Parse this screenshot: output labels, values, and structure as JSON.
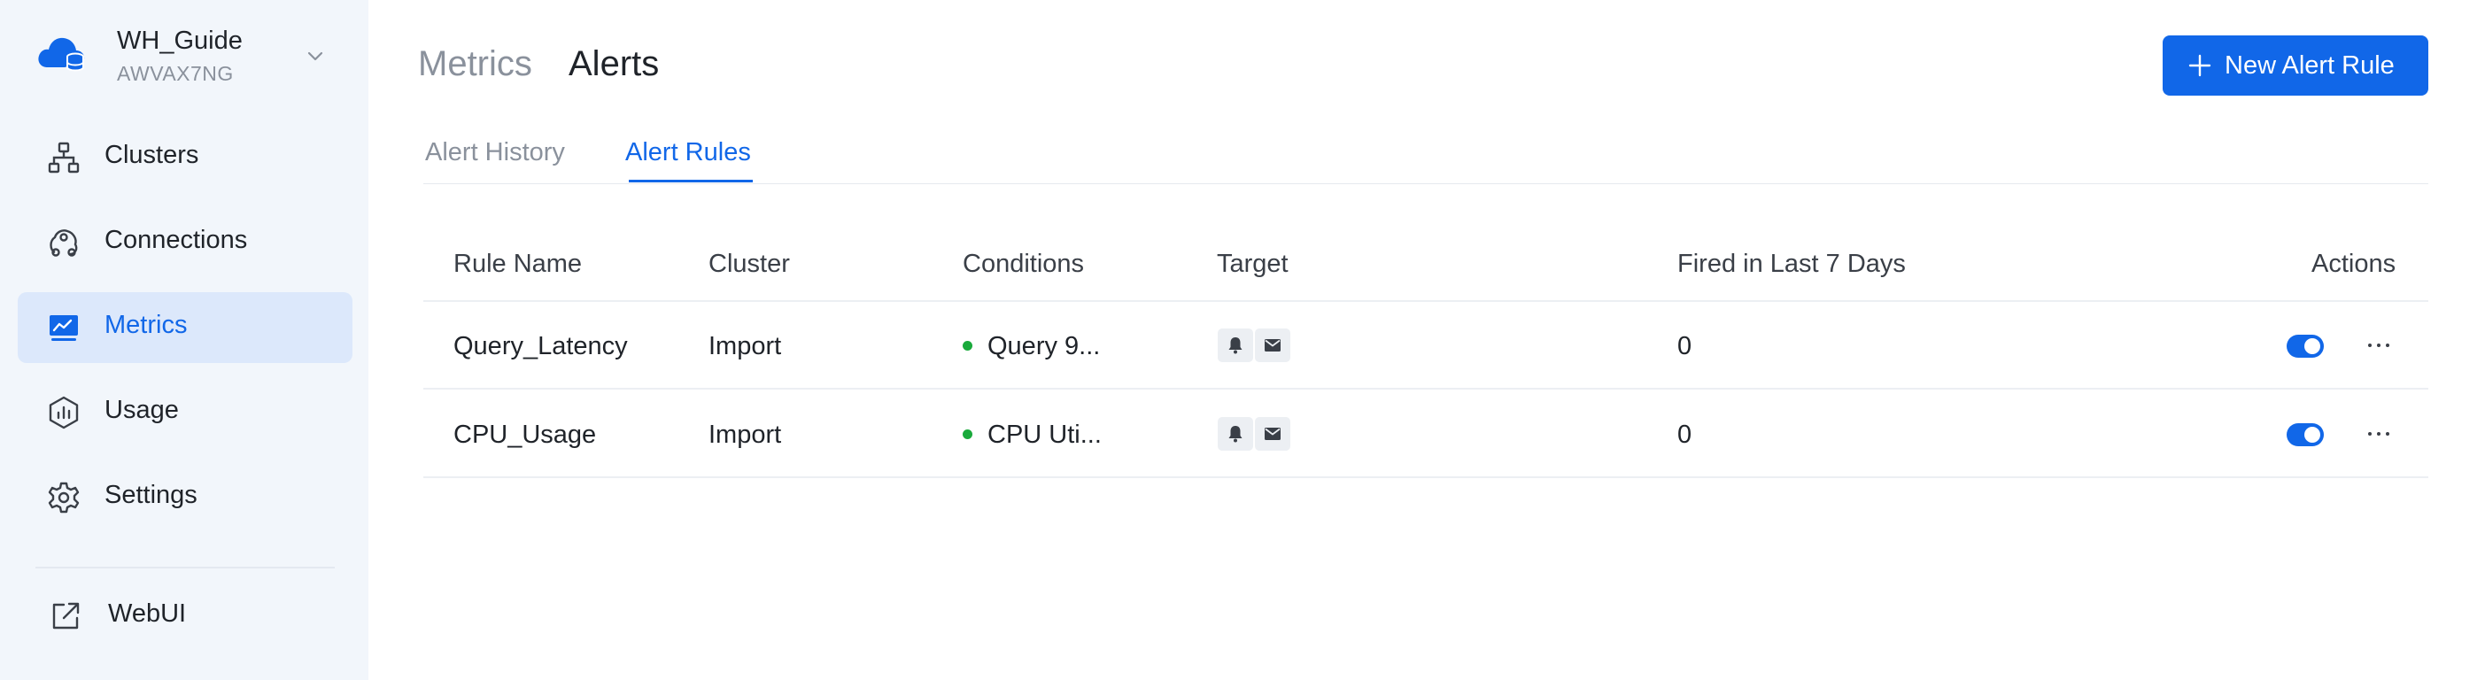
{
  "workspace": {
    "name": "WH_Guide",
    "id": "AWVAX7NG",
    "logo_icon": "cloud-database-icon"
  },
  "sidebar": {
    "items": [
      {
        "label": "Clusters",
        "icon": "clusters-icon"
      },
      {
        "label": "Connections",
        "icon": "connections-icon"
      },
      {
        "label": "Metrics",
        "icon": "metrics-icon",
        "active": true
      },
      {
        "label": "Usage",
        "icon": "usage-icon"
      },
      {
        "label": "Settings",
        "icon": "gear-icon"
      },
      {
        "label": "WebUI",
        "icon": "external-link-icon"
      }
    ]
  },
  "header": {
    "breadcrumb_parent": "Metrics",
    "title": "Alerts",
    "new_button_label": "New Alert Rule"
  },
  "tabs": [
    {
      "label": "Alert History",
      "active": false
    },
    {
      "label": "Alert Rules",
      "active": true
    }
  ],
  "table": {
    "columns": [
      "Rule Name",
      "Cluster",
      "Conditions",
      "Target",
      "Fired in Last 7 Days",
      "Actions"
    ],
    "rows": [
      {
        "rule_name": "Query_Latency",
        "cluster": "Import",
        "condition": "Query 9...",
        "targets": [
          "bell-icon",
          "mail-icon"
        ],
        "fired": "0",
        "enabled": true
      },
      {
        "rule_name": "CPU_Usage",
        "cluster": "Import",
        "condition": "CPU Uti...",
        "targets": [
          "bell-icon",
          "mail-icon"
        ],
        "fired": "0",
        "enabled": true
      }
    ]
  },
  "colors": {
    "accent": "#1167e8",
    "sidebar_bg": "#f2f6fb",
    "status_green": "#1aaa3c"
  }
}
